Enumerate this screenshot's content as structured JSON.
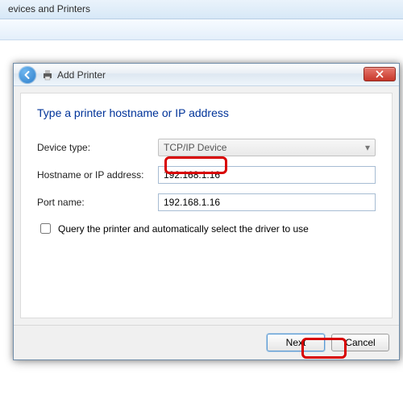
{
  "parent": {
    "title": "evices and Printers"
  },
  "dialog": {
    "title": "Add Printer",
    "heading": "Type a printer hostname or IP address",
    "fields": {
      "device_type_label": "Device type:",
      "device_type_value": "TCP/IP Device",
      "hostname_label": "Hostname or IP address:",
      "hostname_value": "192.168.1.16",
      "port_label": "Port name:",
      "port_value": "192.168.1.16",
      "query_checkbox_label": "Query the printer and automatically select the driver to use"
    },
    "buttons": {
      "next": "Next",
      "cancel": "Cancel"
    }
  }
}
